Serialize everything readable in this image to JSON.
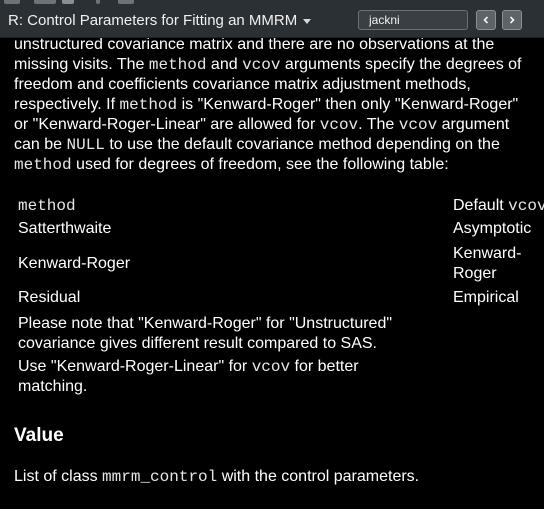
{
  "header": {
    "title": "R: Control Parameters for Fitting an MMRM",
    "search": {
      "value": "jackni",
      "placeholder": ""
    },
    "prev_icon": "chevron-left-icon",
    "next_icon": "chevron-right-icon"
  },
  "doc": {
    "paragraph": {
      "l1": "unstructured covariance matrix and there are no observations at the",
      "l2_a": "missing visits. The ",
      "l2_code1": "method",
      "l2_b": " and ",
      "l2_code2": "vcov",
      "l2_c": " arguments specify the degrees of",
      "l3": "freedom and coefficients covariance matrix adjustment methods,",
      "l4_a": "respectively. If ",
      "l4_code": "method",
      "l4_b": " is \"Kenward-Roger\" then only \"Kenward-Roger\"",
      "l5_a": "or \"Kenward-Roger-Linear\" are allowed for ",
      "l5_code": "vcov",
      "l5_b": ". The ",
      "l5_code2": "vcov",
      "l5_c": " argument",
      "l6_a": "can be ",
      "l6_code": "NULL",
      "l6_b": " to use the default covariance method depending on the",
      "l7_code": "method",
      "l7_b": " used for degrees of freedom, see the following table:"
    },
    "table": {
      "header_col1": "method",
      "header_col3_a": "Default ",
      "header_col3_code": "vcov",
      "rows": [
        {
          "method": "Satterthwaite",
          "default": "Asymptotic"
        },
        {
          "method": "Kenward-Roger",
          "default_l1": "Kenward-",
          "default_l2": "Roger"
        },
        {
          "method": "Residual",
          "default": "Empirical"
        }
      ],
      "note1_l1": "Please note that \"Kenward-Roger\" for \"Unstructured\"",
      "note1_l2": "covariance gives different result compared to SAS.",
      "note2_l1_a": "Use \"Kenward-Roger-Linear\" for ",
      "note2_l1_code": "vcov",
      "note2_l1_b": " for better",
      "note2_l2": "matching."
    },
    "value_section": {
      "heading": "Value",
      "text_a": "List of class ",
      "text_code": "mmrm_control",
      "text_b": " with the control parameters."
    }
  },
  "colors": {
    "background": "#000000",
    "toolbar": "#2b3035",
    "text": "#ffffff"
  }
}
